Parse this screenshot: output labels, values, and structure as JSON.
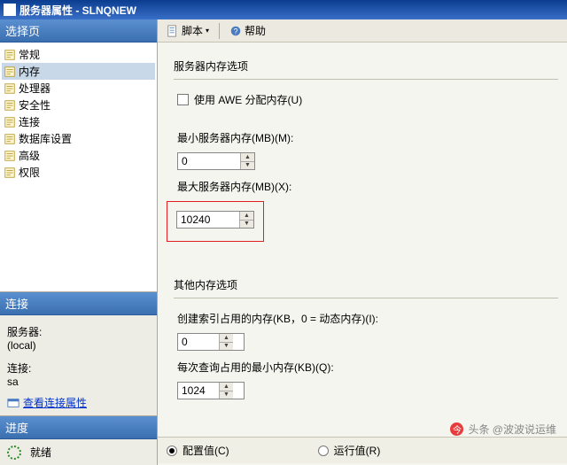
{
  "window": {
    "title": "服务器属性 - SLNQNEW"
  },
  "sidebar": {
    "pages_header": "选择页",
    "items": [
      {
        "label": "常规"
      },
      {
        "label": "内存",
        "selected": true
      },
      {
        "label": "处理器"
      },
      {
        "label": "安全性"
      },
      {
        "label": "连接"
      },
      {
        "label": "数据库设置"
      },
      {
        "label": "高级"
      },
      {
        "label": "权限"
      }
    ],
    "connection": {
      "header": "连接",
      "server_label": "服务器:",
      "server_value": "(local)",
      "conn_label": "连接:",
      "conn_value": "sa",
      "view_props": "查看连接属性"
    },
    "progress": {
      "header": "进度",
      "status": "就绪"
    }
  },
  "toolbar": {
    "script": "脚本",
    "help": "帮助"
  },
  "form": {
    "server_mem_header": "服务器内存选项",
    "use_awe": "使用 AWE 分配内存(U)",
    "min_mem_label": "最小服务器内存(MB)(M):",
    "min_mem_value": "0",
    "max_mem_label": "最大服务器内存(MB)(X):",
    "max_mem_value": "10240",
    "other_mem_header": "其他内存选项",
    "index_mem_label": "创建索引占用的内存(KB，0 = 动态内存)(I):",
    "index_mem_value": "0",
    "query_mem_label": "每次查询占用的最小内存(KB)(Q):",
    "query_mem_value": "1024",
    "radio_config": "配置值(C)",
    "radio_running": "运行值(R)"
  },
  "watermark": "头条 @波波说运维"
}
